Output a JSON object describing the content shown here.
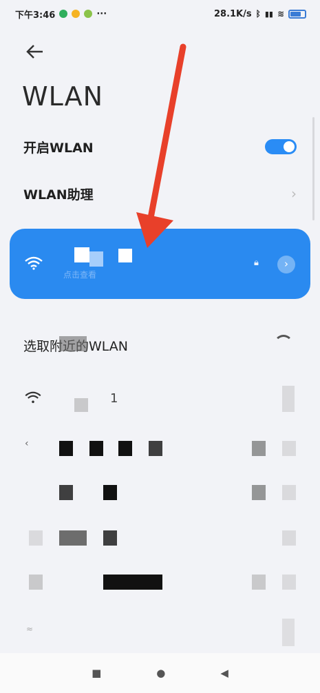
{
  "status_bar": {
    "time": "下午3:46",
    "more": "···",
    "speed": "28.1K/s"
  },
  "header": {
    "title": "WLAN"
  },
  "settings": {
    "wlan_toggle_label": "开启WLAN",
    "wlan_toggle_on": true,
    "assistant_label": "WLAN助理"
  },
  "connected": {
    "network_name": "■ ■",
    "subtitle": "点击查看"
  },
  "networks": {
    "section_title": "选取附近的WLAN",
    "items": [
      {
        "name": "1"
      },
      {
        "name": ""
      },
      {
        "name": ""
      },
      {
        "name": ""
      },
      {
        "name": ""
      },
      {
        "name": ""
      }
    ]
  },
  "nav_bar": {
    "recents_icon": "■",
    "home_icon": "●",
    "back_icon": "◀"
  },
  "colors": {
    "accent": "#2a8af0",
    "toggle_on": "#2a8cf5",
    "annotation_arrow": "#e8402a"
  }
}
